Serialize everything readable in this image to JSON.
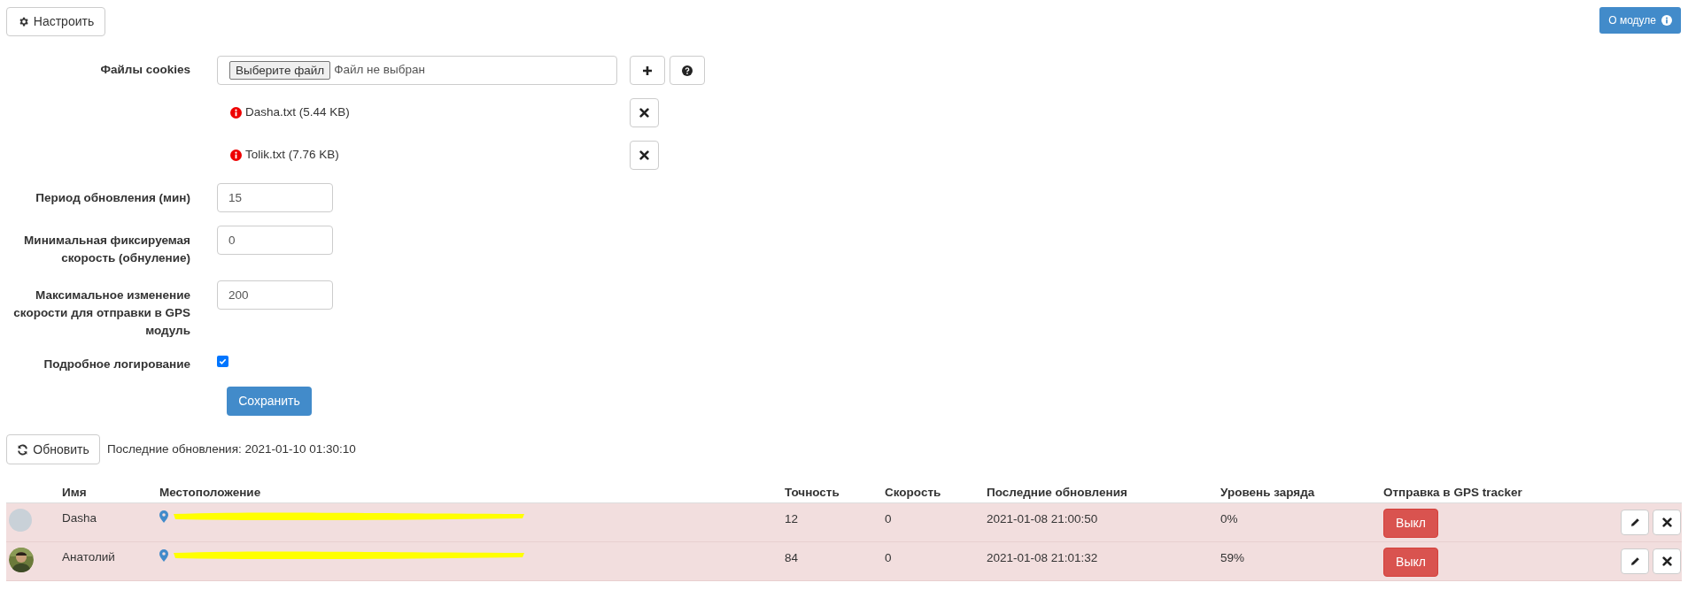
{
  "toolbar": {
    "configure_button": "Настроить",
    "about_button": "О модуле"
  },
  "settings": {
    "cookies": {
      "label": "Файлы cookies",
      "file_button": "Выберите файл",
      "file_status": "Файл не выбран",
      "files": [
        {
          "name": "Dasha.txt (5.44 KB)"
        },
        {
          "name": "Tolik.txt (7.76 KB)"
        }
      ]
    },
    "fields": [
      {
        "label": "Период обновления (мин)",
        "value": "15"
      },
      {
        "label": "Минимальная фиксируемая скорость (обнуление)",
        "value": "0"
      },
      {
        "label": "Максимальное изменение скорости для отправки в GPS модуль",
        "value": "200"
      }
    ],
    "verbose_logging": {
      "label": "Подробное логирование",
      "checked": true
    },
    "save_button": "Сохранить"
  },
  "refresh": {
    "button": "Обновить",
    "last_update": "Последние обновления: 2021-01-10 01:30:10"
  },
  "table": {
    "columns": [
      "Имя",
      "Местоположение",
      "Точность",
      "Скорость",
      "Последние обновления",
      "Уровень заряда",
      "Отправка в GPS tracker"
    ],
    "rows": [
      {
        "avatar": {
          "kind": "placeholder"
        },
        "name": "Dasha",
        "location_redacted": true,
        "accuracy": "12",
        "speed": "0",
        "updated": "2021-01-08 21:00:50",
        "battery": "0%",
        "gps_button": "Выкл"
      },
      {
        "name": "Анатолий",
        "location_redacted": true,
        "accuracy": "84",
        "speed": "0",
        "updated": "2021-01-08 21:01:32",
        "battery": "59%",
        "gps_button": "Выкл"
      }
    ]
  }
}
